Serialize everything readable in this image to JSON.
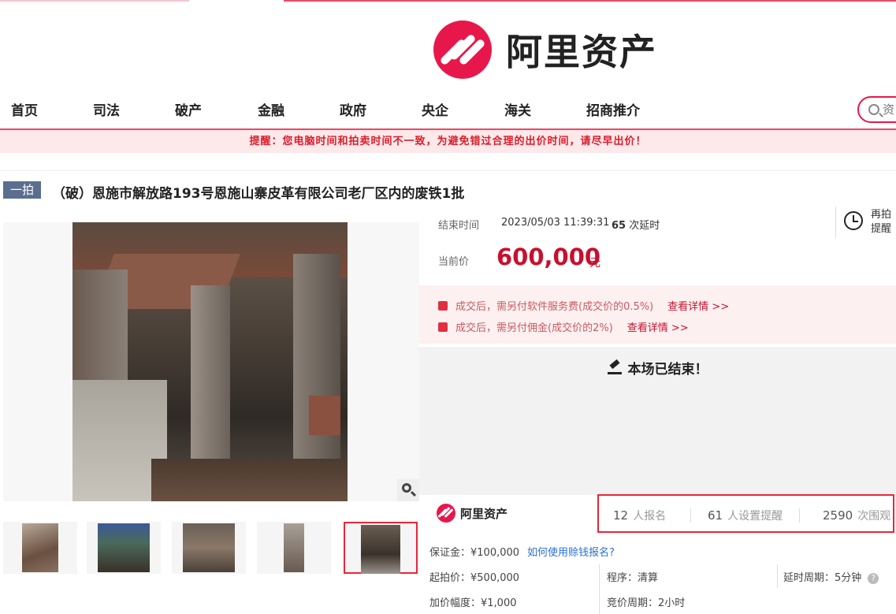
{
  "brand": {
    "name": "阿里资产",
    "accent": "#e8174b"
  },
  "nav": {
    "items": [
      "首页",
      "司法",
      "破产",
      "金融",
      "政府",
      "央企",
      "海关",
      "招商推介"
    ],
    "search_placeholder": "资"
  },
  "reminder": "提醒：您电脑时间和拍卖时间不一致，为避免错过合理的出价时间，请尽早出价！",
  "listing": {
    "type_tag": "一拍",
    "title": "（破）恩施市解放路193号恩施山寨皮革有限公司老厂区内的废铁1批"
  },
  "auction": {
    "end_label": "结束时间",
    "end_time": "2023/05/03 11:39:31",
    "delay_count": "65",
    "delay_suffix": "次延时",
    "remind_line1": "再拍",
    "remind_line2": "提醒",
    "price_label": "当前价",
    "price_value": "600,000",
    "price_unit": "元"
  },
  "fees": [
    {
      "text": "成交后，需另付软件服务费(成交价的0.5%)",
      "link": "查看详情 >>"
    },
    {
      "text": "成交后，需另付佣金(成交价的2%)",
      "link": "查看详情 >>"
    }
  ],
  "ended_message": "本场已结束！",
  "stats": {
    "logo_text": "阿里资产",
    "registered": "12",
    "registered_unit": "人报名",
    "reminders": "61",
    "reminders_unit": "人设置提醒",
    "watchers": "2590",
    "watchers_unit": "次围观"
  },
  "details": {
    "deposit": "保证金：¥100,000",
    "deposit_link": "如何使用赊钱报名?",
    "start_price": "起拍价：¥500,000",
    "procedure": "程序：清算",
    "delay_period": "延时周期：5分钟",
    "increment": "加价幅度：¥1,000",
    "bid_period": "竞价周期：2小时"
  }
}
